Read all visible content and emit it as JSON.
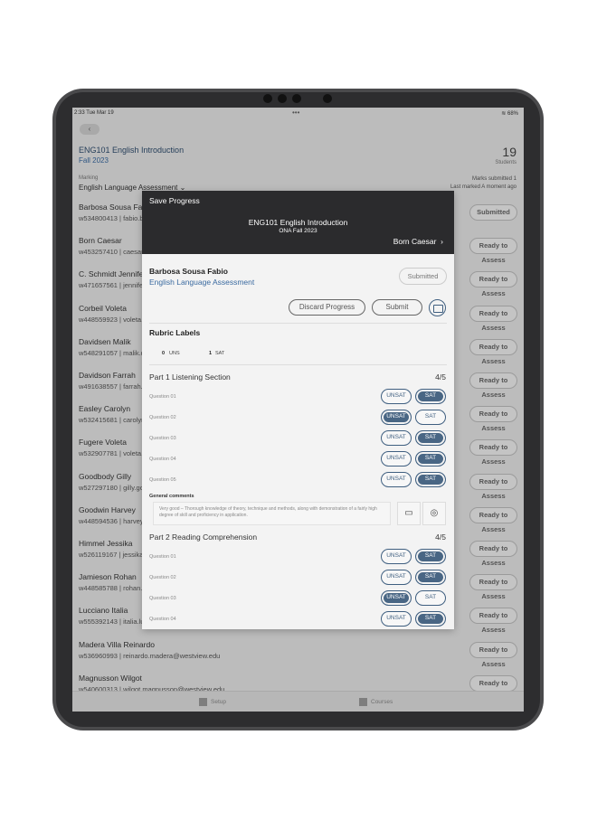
{
  "status_bar": {
    "time": "2:33 Tue Mar 19",
    "battery": "68%"
  },
  "header": {
    "course": "ENG101 English Introduction",
    "term": "Fall 2023",
    "student_count": "19",
    "student_count_label": "Students",
    "marking_label": "Marking",
    "marking_value": "English Language Assessment",
    "marks_submitted": "Marks submitted  1",
    "last_marked": "Last marked   A moment ago"
  },
  "students": [
    {
      "name": "Barbosa Sousa Fabio",
      "id": "w534800413  |  fabio.barbosa@westview.edu",
      "status": "Submitted"
    },
    {
      "name": "Born Caesar",
      "id": "w453257410  |  caesar.born@westview.edu",
      "status": "Ready to Assess"
    },
    {
      "name": "C. Schmidt Jennifer",
      "id": "w471657561  |  jennifer.schmidt@westview.edu",
      "status": "Ready to Assess"
    },
    {
      "name": "Corbeil Voleta",
      "id": "w448559923  |  voleta.corbeil@westview.edu",
      "status": "Ready to Assess"
    },
    {
      "name": "Davidsen  Malik",
      "id": "w548291057  |  malik.davidsen@westview.edu",
      "status": "Ready to Assess"
    },
    {
      "name": "Davidson Farrah",
      "id": "w491638557  |  farrah.davidson@westview.edu",
      "status": "Ready to Assess"
    },
    {
      "name": "Easley Carolyn",
      "id": "w532415681  |  carolyn.easley@westview.edu",
      "status": "Ready to Assess"
    },
    {
      "name": "Fugere Voleta",
      "id": "w532907781  |  voleta.fugere@westview.edu",
      "status": "Ready to Assess"
    },
    {
      "name": "Goodbody Gilly",
      "id": "w527297180  |  gilly.goodbody@westview.edu",
      "status": "Ready to Assess"
    },
    {
      "name": "Goodwin  Harvey",
      "id": "w448594536  |  harvey.goodwin@westview.edu",
      "status": "Ready to Assess"
    },
    {
      "name": "Himmel    Jessika",
      "id": "w526119167  |  jessika.himmel@westview.edu",
      "status": "Ready to Assess"
    },
    {
      "name": "Jamieson Rohan",
      "id": "w448585788  |  rohan.jamieson@westview.edu",
      "status": "Ready to Assess"
    },
    {
      "name": "Lucciano Italia",
      "id": "w555392143  |  italia.lucciano@westview.edu",
      "status": "Ready to Assess"
    },
    {
      "name": "Madera Villa Reinardo",
      "id": "w536960993  |  reinardo.madera@westview.edu",
      "status": "Ready to Assess"
    },
    {
      "name": "Magnusson Wilgot",
      "id": "w540600313  |  wilgot.magnusson@westview.edu",
      "status": "Ready to Assess"
    }
  ],
  "tabs": {
    "setup": "Setup",
    "courses": "Courses"
  },
  "modal": {
    "title": "Save Progress",
    "course": "ENG101 English Introduction",
    "term": "ONA Fall 2023",
    "next_student": "Born Caesar",
    "student_name": "Barbosa Sousa Fabio",
    "assessment": "English Language Assessment",
    "badge": "Submitted",
    "discard": "Discard Progress",
    "submit": "Submit",
    "rubric_title": "Rubric Labels",
    "legend": [
      {
        "num": "0",
        "label": "UNS"
      },
      {
        "num": "1",
        "label": "SAT"
      }
    ],
    "option_unsat": "UNSAT",
    "option_sat": "SAT",
    "part1": {
      "title": "Part 1 Listening Section",
      "score": "4/5",
      "questions": [
        {
          "label": "Question 01",
          "selected": "SAT"
        },
        {
          "label": "Question 02",
          "selected": "UNSAT"
        },
        {
          "label": "Question 03",
          "selected": "SAT"
        },
        {
          "label": "Question 04",
          "selected": "SAT"
        },
        {
          "label": "Question 05",
          "selected": "SAT"
        }
      ]
    },
    "general_comments_label": "General comments",
    "general_comments": "Very good – Thorough knowledge of theory, technique and methods, along with demonstration of a fairly high degree of skill and proficiency in application.",
    "part2": {
      "title": "Part 2 Reading Comprehension",
      "score": "4/5",
      "questions": [
        {
          "label": "Question 01",
          "selected": "SAT"
        },
        {
          "label": "Question 02",
          "selected": "SAT"
        },
        {
          "label": "Question 03",
          "selected": "UNSAT"
        },
        {
          "label": "Question 04",
          "selected": "SAT"
        }
      ]
    }
  }
}
